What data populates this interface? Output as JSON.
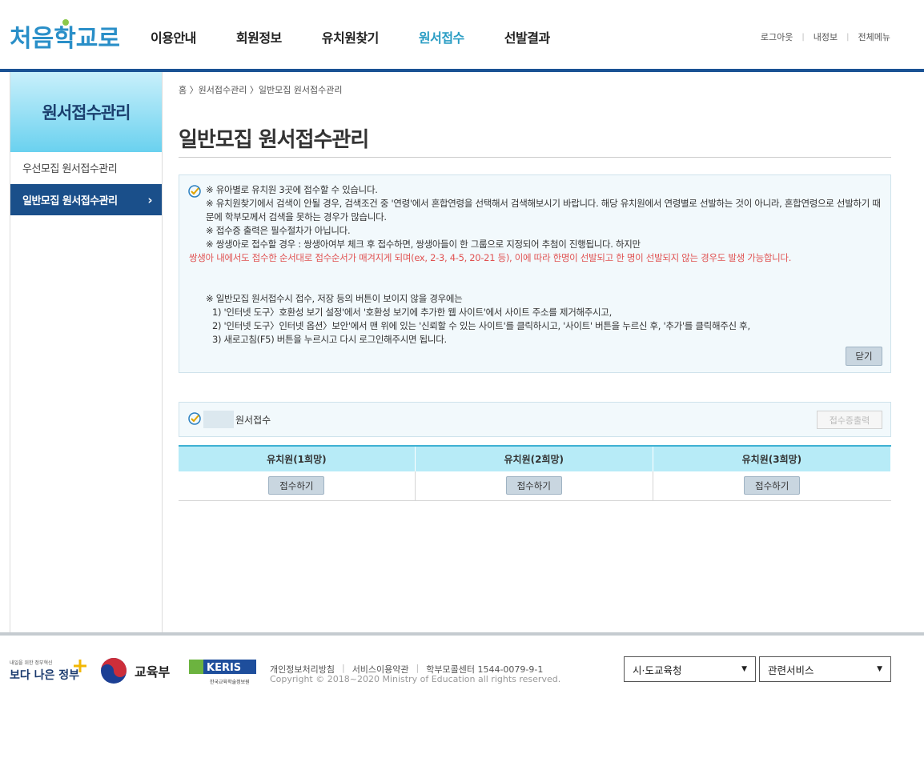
{
  "header": {
    "logo_text": "처음학교로",
    "nav": [
      "이용안내",
      "회원정보",
      "유치원찾기",
      "원서접수",
      "선발결과"
    ],
    "active_nav": "원서접수",
    "util": [
      "로그아웃",
      "내정보",
      "전체메뉴"
    ]
  },
  "lnb": {
    "title": "원서접수관리",
    "items": [
      "우선모집 원서접수관리",
      "일반모집 원서접수관리"
    ],
    "active_arrow": "›"
  },
  "content": {
    "breadcrumb": "홈 〉원서접수관리 〉일반모집 원서접수관리",
    "title": "일반모집 원서접수관리",
    "notice": {
      "lines": [
        "※ 유아별로 유치원 3곳에 접수할 수 있습니다.",
        "※ 유치원찾기에서 검색이 안될 경우, 검색조건 중 '연령'에서 혼합연령을 선택해서 검색해보시기 바랍니다. 해당 유치원에서 연령별로 선발하는 것이 아니라, 혼합연령으로 선발하기 때문에 학부모께서 검색을 못하는 경우가 많습니다.",
        "※ 접수증 출력은 필수절차가 아닙니다.",
        "※ 쌍생아로 접수할 경우 : 쌍생아여부 체크 후 접수하면, 쌍생아들이 한 그룹으로 지정되어 추첨이 진행됩니다. 하지만"
      ],
      "red_line": "쌍생아 내에서도 접수한 순서대로 접수순서가 매겨지게 되며(ex, 2-3, 4-5, 20-21 등), 이에 따라 한명이 선발되고 한 명이 선발되지 않는 경우도 발생 가능합니다.",
      "lines2": [
        "※ 일반모집 원서접수시 접수, 저장 등의 버튼이 보이지 않을 경우에는",
        "1) '인터넷 도구〉호환성 보기 설정'에서 '호환성 보기에 추가한 웹 사이트'에서 사이트 주소를 제거해주시고,",
        "2) '인터넷 도구〉인터넷 옵션〉보안'에서 맨 위에 있는 '신뢰할 수 있는 사이트'를 클릭하시고, '사이트' 버튼을 누르신 후, '추가'를 클릭해주신 후,",
        "3) 새로고침(F5) 버튼을 누르시고 다시 로그인해주시면 됩니다."
      ],
      "close_label": "닫기"
    },
    "apply": {
      "label": "원서접수",
      "print_label": "접수증출력"
    },
    "table": {
      "headers": [
        "유치원(1희망)",
        "유치원(2희망)",
        "유치원(3희망)"
      ],
      "button_label": "접수하기"
    }
  },
  "footer": {
    "gov_logo_small": "내일을 위한 정부혁신",
    "gov_logo_text": "보다 나은 정부",
    "moe_text": "교육부",
    "keris_text": "KERIS",
    "keris_sub": "한국교육학술정보원",
    "links": [
      "개인정보처리방침",
      "서비스이용약관",
      "학부모콜센터 1544-0079-9-1"
    ],
    "copyright": "Copyright © 2018~2020 Ministry of Education all rights reserved.",
    "select1": "시·도교육청",
    "select2": "관련서비스",
    "select_arrow": "▼"
  },
  "colors": {
    "accent_blue": "#1a5294",
    "active_nav": "#2a9dc4",
    "table_header": "#b7ebf7",
    "red_text": "#e05252"
  }
}
